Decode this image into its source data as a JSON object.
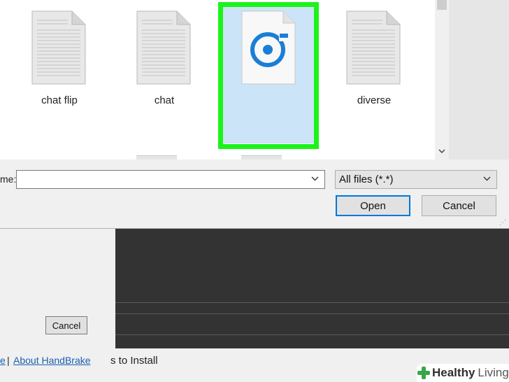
{
  "files": [
    {
      "name": "chat flip",
      "icon": "text-document-icon"
    },
    {
      "name": "chat",
      "icon": "text-document-icon"
    },
    {
      "name": "",
      "icon": "groove-music-file-icon",
      "selected": true
    },
    {
      "name": "diverse",
      "icon": "text-document-icon"
    }
  ],
  "dialog": {
    "filename_label": "me:",
    "filename_value": "",
    "filter": "All files (*.*)",
    "open_label": "Open",
    "cancel_label": "Cancel"
  },
  "background_app": {
    "cancel_label": "Cancel",
    "link_partial": "e",
    "separator": "|",
    "about_link": "About HandBrake",
    "install_text": "s to Install"
  },
  "watermark": {
    "word1": "Healthy",
    "word2": "Living"
  },
  "colors": {
    "highlight": "#1cf31a",
    "selection": "#cce4f7",
    "groove_blue": "#1b7ed6"
  }
}
